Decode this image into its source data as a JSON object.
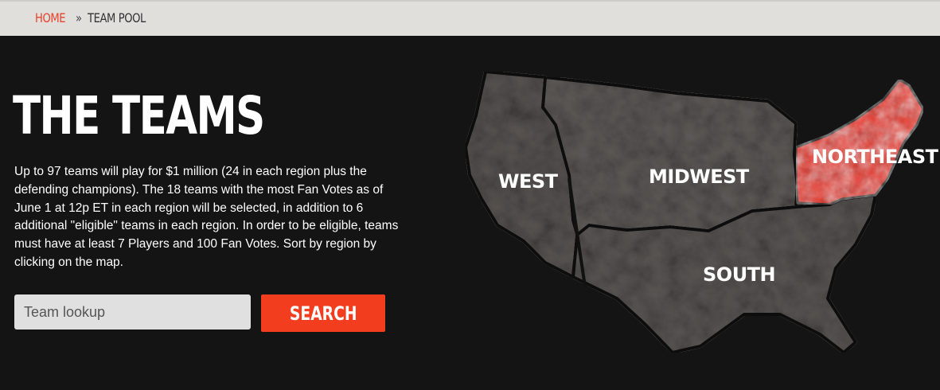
{
  "breadcrumb": {
    "home": "HOME",
    "separator": "»",
    "current": "TEAM POOL"
  },
  "page": {
    "title": "THE TEAMS",
    "description": "Up to 97 teams will play for $1 million (24 in each region plus the defending champions). The 18 teams with the most Fan Votes as of June 1 at 12p ET in each region will be selected, in addition to 6 additional \"eligible\" teams in each region. In order to be eligible, teams must have at least 7 Players and 100 Fan Votes. Sort by region by clicking on the map."
  },
  "search": {
    "placeholder": "Team lookup",
    "value": "",
    "button_label": "SEARCH"
  },
  "map": {
    "regions": {
      "west": "WEST",
      "midwest": "MIDWEST",
      "south": "SOUTH",
      "northeast": "NORTHEAST"
    },
    "selected_region": "northeast"
  },
  "colors": {
    "accent": "#f23d1f",
    "background": "#141414",
    "breadcrumb_bg": "#e0dfdc",
    "region_gray": "#5b5755",
    "region_selected": "#e8331e"
  }
}
